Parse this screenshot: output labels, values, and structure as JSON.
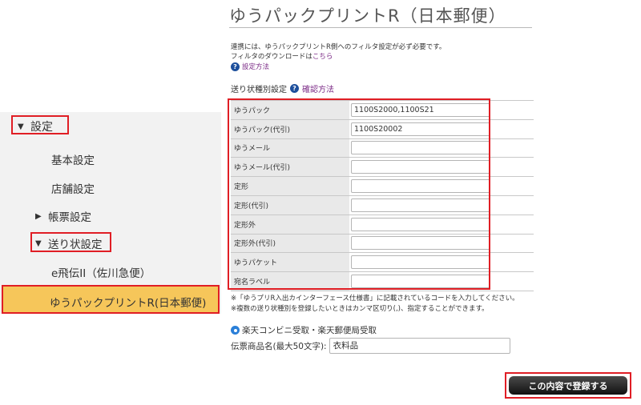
{
  "sidebar": {
    "settings_label": "設定",
    "basic_label": "基本設定",
    "store_label": "店舗設定",
    "forms_label": "帳票設定",
    "shipping_label": "送り状設定",
    "e_hiden_label": "e飛伝II（佐川急便）",
    "yupack_label": "ゆうパックプリントR(日本郵便)"
  },
  "main": {
    "title": "ゆうパックプリントR（日本郵便）",
    "note1": "連携には、ゆうパックプリントR側へのフィルタ設定が必ず必要です。",
    "note2_prefix": "フィルタのダウンロードは",
    "note2_link": "こちら",
    "setup_link": "設定方法",
    "section_label": "送り状種別設定",
    "confirm_link": "確認方法",
    "rows": [
      {
        "label": "ゆうパック",
        "value": "1100S2000,1100S21"
      },
      {
        "label": "ゆうパック(代引)",
        "value": "1100S20002"
      },
      {
        "label": "ゆうメール",
        "value": ""
      },
      {
        "label": "ゆうメール(代引)",
        "value": ""
      },
      {
        "label": "定形",
        "value": ""
      },
      {
        "label": "定形(代引)",
        "value": ""
      },
      {
        "label": "定形外",
        "value": ""
      },
      {
        "label": "定形外(代引)",
        "value": ""
      },
      {
        "label": "ゆうパケット",
        "value": ""
      },
      {
        "label": "宛名ラベル",
        "value": ""
      }
    ],
    "footnote1": "※「ゆうプリR入出カインターフェース仕様書」に記載されているコードを入力してください。",
    "footnote2": "※複数の送り状種別を登録したいときはカンマ区切り(,)、指定することができます。",
    "radio_label": "楽天コンビニ受取・楽天郵便局受取",
    "item_label": "伝票商品名(最大50文字):",
    "item_value": "衣料品",
    "submit_label": "この内容で登録する"
  }
}
